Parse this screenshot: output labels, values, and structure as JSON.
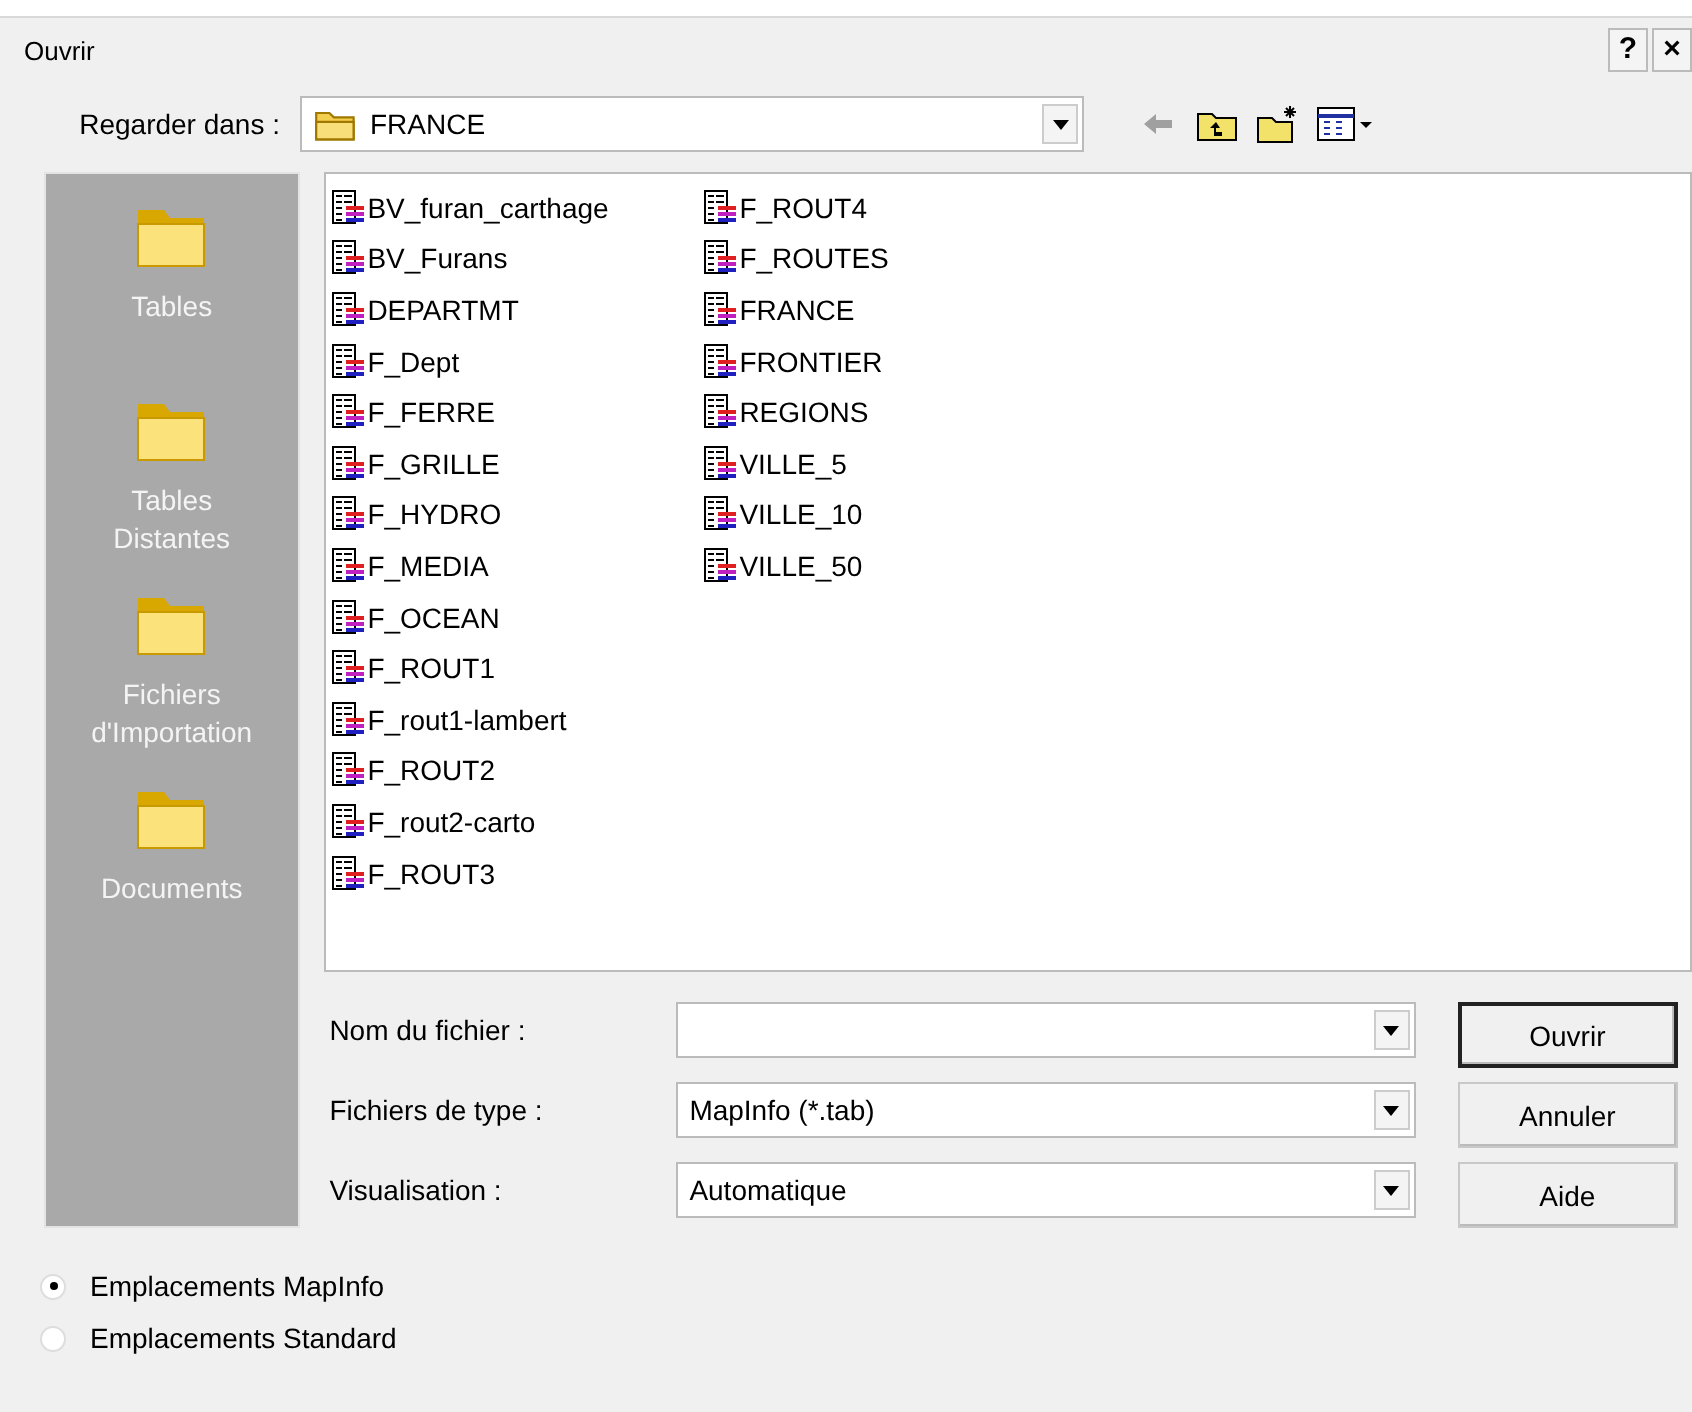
{
  "window": {
    "title": "Ouvrir",
    "help_button": "?",
    "close_button": "×"
  },
  "look_in": {
    "label": "Regarder dans :",
    "value": "FRANCE"
  },
  "sidebar": {
    "items": [
      {
        "label": "Tables"
      },
      {
        "label": "Tables Distantes"
      },
      {
        "label": "Fichiers d'Importation"
      },
      {
        "label": "Documents"
      }
    ]
  },
  "files": [
    "BV_furan_carthage",
    "BV_Furans",
    "DEPARTMT",
    "F_Dept",
    "F_FERRE",
    "F_GRILLE",
    "F_HYDRO",
    "F_MEDIA",
    "F_OCEAN",
    "F_ROUT1",
    "F_rout1-lambert",
    "F_ROUT2",
    "F_rout2-carto",
    "F_ROUT3",
    "F_ROUT4",
    "F_ROUTES",
    "FRANCE",
    "FRONTIER",
    "REGIONS",
    "VILLE_5",
    "VILLE_10",
    "VILLE_50"
  ],
  "fields": [
    {
      "label": "Nom du fichier :"
    },
    {
      "label": "Fichiers de type :",
      "value": "MapInfo (*.tab)"
    },
    {
      "label": "Visualisation :",
      "value": "Automatique"
    }
  ],
  "buttons": [
    {
      "label": "Ouvrir",
      "default": true
    },
    {
      "label": "Annuler",
      "default": false
    },
    {
      "label": "Aide",
      "default": false
    }
  ],
  "locations": [
    {
      "label": "Emplacements MapInfo",
      "selected": true
    },
    {
      "label": "Emplacements Standard",
      "selected": false
    }
  ]
}
